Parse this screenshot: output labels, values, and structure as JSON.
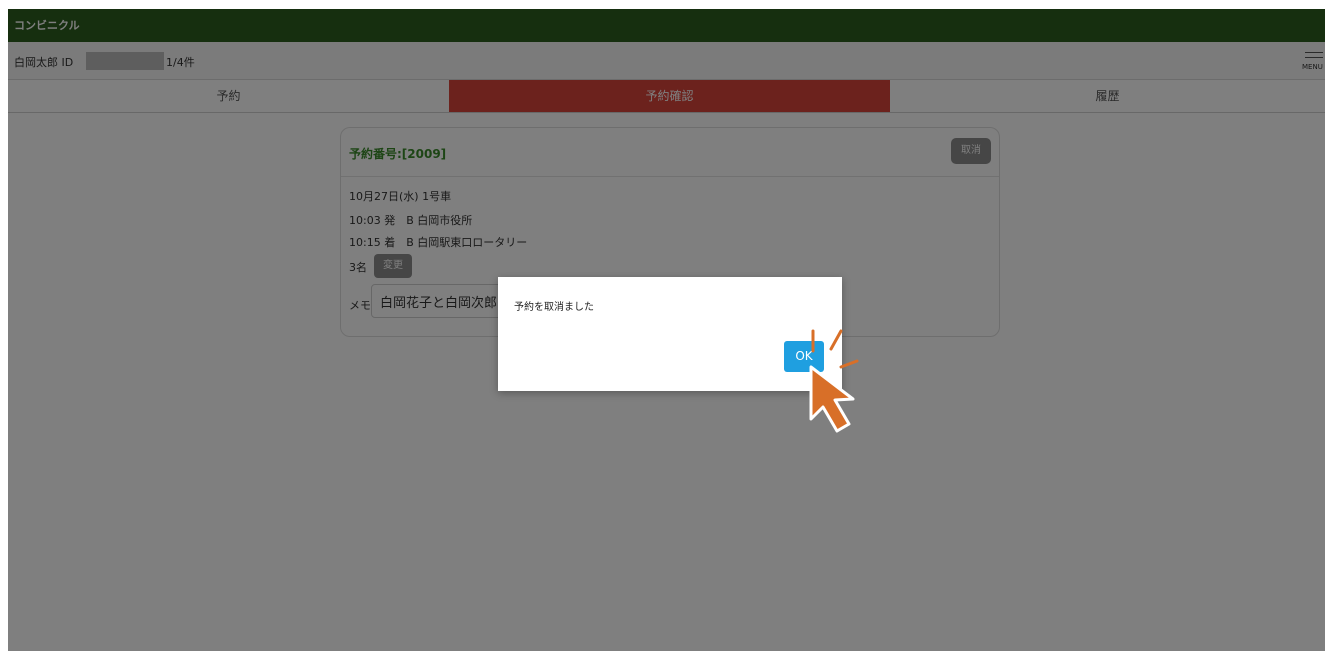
{
  "app": {
    "title": "コンビニクル"
  },
  "user": {
    "name": "白岡太郎 ID",
    "count": "1/4件",
    "menu_label": "MENU"
  },
  "tabs": [
    {
      "label": "予約",
      "active": false
    },
    {
      "label": "予約確認",
      "active": true
    },
    {
      "label": "履歴",
      "active": false
    }
  ],
  "reservation": {
    "number": "予約番号:[2009]",
    "cancel_label": "取消",
    "date_line": "10月27日(水) 1号車",
    "depart_line": "10:03 発　B 白岡市役所",
    "arrive_line": "10:15 着　B 白岡駅東口ロータリー",
    "people": "3名",
    "change_label": "変更",
    "memo_label": "メモ",
    "memo_value": "白岡花子と白岡次郎"
  },
  "dialog": {
    "message": "予約を取消ました",
    "ok_label": "OK"
  },
  "colors": {
    "header": "#2d5e1e",
    "active_tab": "#d9443b",
    "ok_button": "#1f9fe0",
    "annotation": "#d86f28"
  }
}
